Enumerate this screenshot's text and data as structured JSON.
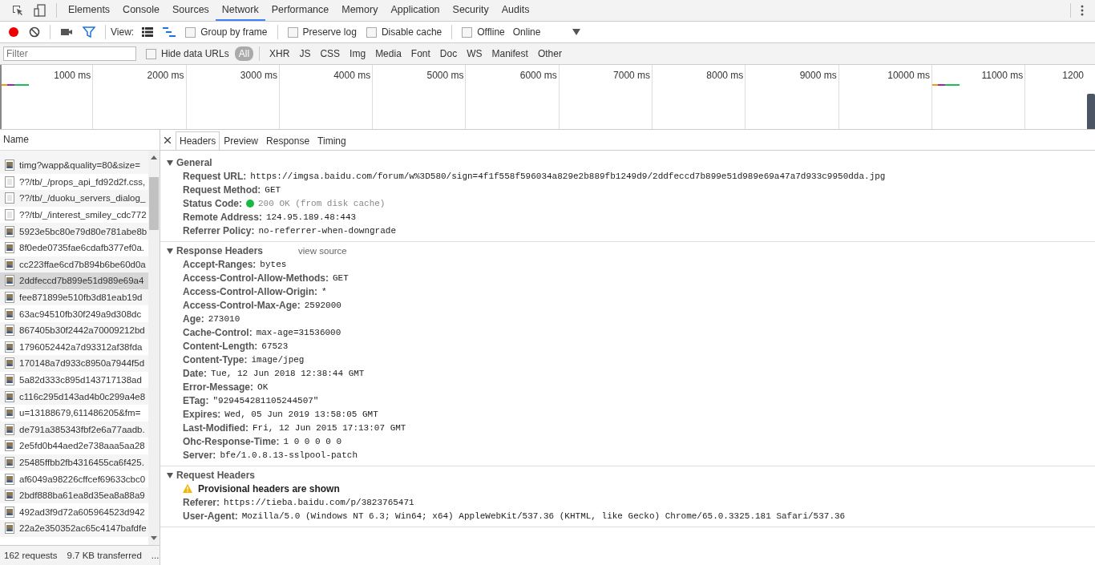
{
  "panel_tabs": [
    {
      "label": "Elements",
      "selected": false
    },
    {
      "label": "Console",
      "selected": false
    },
    {
      "label": "Sources",
      "selected": false
    },
    {
      "label": "Network",
      "selected": true
    },
    {
      "label": "Performance",
      "selected": false
    },
    {
      "label": "Memory",
      "selected": false
    },
    {
      "label": "Application",
      "selected": false
    },
    {
      "label": "Security",
      "selected": false
    },
    {
      "label": "Audits",
      "selected": false
    }
  ],
  "toolbar": {
    "recording": true,
    "filter_on": true,
    "view_label": "View:",
    "options": [
      {
        "label": "Group by frame",
        "checked": false
      },
      {
        "label": "Preserve log",
        "checked": false
      },
      {
        "label": "Disable cache",
        "checked": false
      },
      {
        "label": "Offline",
        "checked": false
      }
    ],
    "throttling": "Online"
  },
  "filter_bar": {
    "placeholder": "Filter",
    "hide_data_urls": {
      "label": "Hide data URLs",
      "checked": false
    },
    "types": [
      {
        "label": "All",
        "selected": true
      },
      {
        "label": "XHR",
        "selected": false
      },
      {
        "label": "JS",
        "selected": false
      },
      {
        "label": "CSS",
        "selected": false
      },
      {
        "label": "Img",
        "selected": false
      },
      {
        "label": "Media",
        "selected": false
      },
      {
        "label": "Font",
        "selected": false
      },
      {
        "label": "Doc",
        "selected": false
      },
      {
        "label": "WS",
        "selected": false
      },
      {
        "label": "Manifest",
        "selected": false
      },
      {
        "label": "Other",
        "selected": false
      }
    ]
  },
  "timeline": {
    "ticks": [
      "1000 ms",
      "2000 ms",
      "3000 ms",
      "4000 ms",
      "5000 ms",
      "6000 ms",
      "7000 ms",
      "8000 ms",
      "9000 ms",
      "10000 ms",
      "11000 ms",
      "1200"
    ]
  },
  "requests": {
    "column": "Name",
    "rows": [
      {
        "name": "timg?wapp&quality=80&size=",
        "kind": "image",
        "selected": false
      },
      {
        "name": "??/tb/_/props_api_fd92d2f.css,",
        "kind": "document",
        "selected": false
      },
      {
        "name": "??/tb/_/duoku_servers_dialog_",
        "kind": "document",
        "selected": false
      },
      {
        "name": "??/tb/_/interest_smiley_cdc772",
        "kind": "document",
        "selected": false
      },
      {
        "name": "5923e5bc80e79d80e781abe8b",
        "kind": "image",
        "selected": false
      },
      {
        "name": "8f0ede0735fae6cdafb377ef0a.",
        "kind": "image",
        "selected": false
      },
      {
        "name": "cc223ffae6cd7b894b6be60d0a",
        "kind": "image",
        "selected": false
      },
      {
        "name": "2ddfeccd7b899e51d989e69a4",
        "kind": "image",
        "selected": true
      },
      {
        "name": "fee871899e510fb3d81eab19d",
        "kind": "image",
        "selected": false
      },
      {
        "name": "63ac94510fb30f249a9d308dc",
        "kind": "image",
        "selected": false
      },
      {
        "name": "867405b30f2442a70009212bd",
        "kind": "image",
        "selected": false
      },
      {
        "name": "1796052442a7d93312af38fda",
        "kind": "image",
        "selected": false
      },
      {
        "name": "170148a7d933c8950a7944f5d",
        "kind": "image",
        "selected": false
      },
      {
        "name": "5a82d333c895d143717138ad",
        "kind": "image",
        "selected": false
      },
      {
        "name": "c116c295d143ad4b0c299a4e8",
        "kind": "image",
        "selected": false
      },
      {
        "name": "u=13188679,611486205&fm=",
        "kind": "image",
        "selected": false
      },
      {
        "name": "de791a385343fbf2e6a77aadb.",
        "kind": "image",
        "selected": false
      },
      {
        "name": "2e5fd0b44aed2e738aaa5aa28",
        "kind": "image",
        "selected": false
      },
      {
        "name": "25485ffbb2fb4316455ca6f425.",
        "kind": "image",
        "selected": false
      },
      {
        "name": "af6049a98226cffcef69633cbc0",
        "kind": "image",
        "selected": false
      },
      {
        "name": "2bdf888ba61ea8d35ea8a88a9",
        "kind": "image",
        "selected": false
      },
      {
        "name": "492ad3f9d72a605964523d942",
        "kind": "image",
        "selected": false
      },
      {
        "name": "22a2e350352ac65c4147bafdfe",
        "kind": "image",
        "selected": false
      }
    ],
    "summary": [
      "162 requests",
      "9.7 KB transferred",
      "..."
    ]
  },
  "detail_tabs": [
    {
      "label": "Headers",
      "selected": true
    },
    {
      "label": "Preview",
      "selected": false
    },
    {
      "label": "Response",
      "selected": false
    },
    {
      "label": "Timing",
      "selected": false
    }
  ],
  "sections": [
    {
      "title": "General",
      "expanded": true,
      "rows": [
        {
          "kind": "field",
          "name": "Request URL:",
          "value": "https://imgsa.baidu.com/forum/w%3D580/sign=4f1f558f596034a829e2b889fb1249d9/2ddfeccd7b899e51d989e69a47a7d933c9950dda.jpg"
        },
        {
          "kind": "field",
          "name": "Request Method:",
          "value": "GET"
        },
        {
          "kind": "status",
          "name": "Status Code:",
          "value": "200 OK (from disk cache)"
        },
        {
          "kind": "field",
          "name": "Remote Address:",
          "value": "124.95.189.48:443"
        },
        {
          "kind": "field",
          "name": "Referrer Policy:",
          "value": "no-referrer-when-downgrade"
        }
      ]
    },
    {
      "title": "Response Headers",
      "expanded": true,
      "link": "view source",
      "rows": [
        {
          "kind": "field",
          "name": "Accept-Ranges:",
          "value": "bytes"
        },
        {
          "kind": "field",
          "name": "Access-Control-Allow-Methods:",
          "value": "GET"
        },
        {
          "kind": "field",
          "name": "Access-Control-Allow-Origin:",
          "value": "*"
        },
        {
          "kind": "field",
          "name": "Access-Control-Max-Age:",
          "value": "2592000"
        },
        {
          "kind": "field",
          "name": "Age:",
          "value": "273010"
        },
        {
          "kind": "field",
          "name": "Cache-Control:",
          "value": "max-age=31536000"
        },
        {
          "kind": "field",
          "name": "Content-Length:",
          "value": "67523"
        },
        {
          "kind": "field",
          "name": "Content-Type:",
          "value": "image/jpeg"
        },
        {
          "kind": "field",
          "name": "Date:",
          "value": "Tue, 12 Jun 2018 12:38:44 GMT"
        },
        {
          "kind": "field",
          "name": "Error-Message:",
          "value": "OK"
        },
        {
          "kind": "field",
          "name": "ETag:",
          "value": "\"929454281105244507\""
        },
        {
          "kind": "field",
          "name": "Expires:",
          "value": "Wed, 05 Jun 2019 13:58:05 GMT"
        },
        {
          "kind": "field",
          "name": "Last-Modified:",
          "value": "Fri, 12 Jun 2015 17:13:07 GMT"
        },
        {
          "kind": "field",
          "name": "Ohc-Response-Time:",
          "value": "1 0 0 0 0 0"
        },
        {
          "kind": "field",
          "name": "Server:",
          "value": "bfe/1.0.8.13-sslpool-patch"
        }
      ]
    },
    {
      "title": "Request Headers",
      "expanded": true,
      "rows": [
        {
          "kind": "warning",
          "value": "Provisional headers are shown"
        },
        {
          "kind": "field",
          "name": "Referer:",
          "value": "https://tieba.baidu.com/p/3823765471"
        },
        {
          "kind": "field",
          "name": "User-Agent:",
          "value": "Mozilla/5.0 (Windows NT 6.3; Win64; x64) AppleWebKit/537.36 (KHTML, like Gecko) Chrome/65.0.3325.181 Safari/537.36"
        }
      ]
    }
  ]
}
